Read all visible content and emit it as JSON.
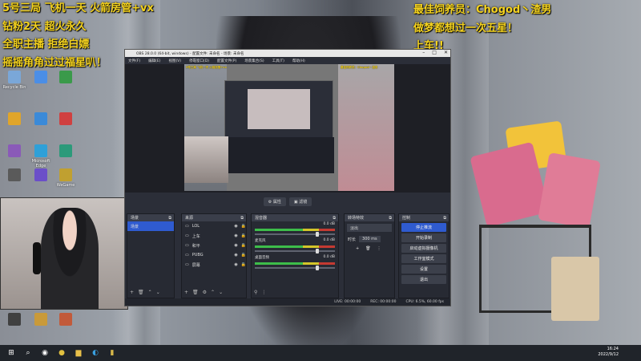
{
  "overlay": {
    "left_lines": [
      "5号三局 飞机一天 火箭房管+vx",
      "钻粉2天  超火永久",
      "全职主播 拒绝白嫖",
      "摇摇角角过过福星叭！"
    ],
    "right_lines": [
      "最佳饲养员：Chogod丶渣男",
      "做梦都想过一次五星！",
      "上车!!"
    ]
  },
  "desktop_icons": [
    {
      "label": "Recycle Bin",
      "color": "#7aa7d8"
    },
    {
      "label": "",
      "color": "#4b8ee6"
    },
    {
      "label": "",
      "color": "#3a9a4a"
    },
    {
      "label": "",
      "color": "#e0a52a"
    },
    {
      "label": "",
      "color": "#3b8ad8"
    },
    {
      "label": "",
      "color": "#d04040"
    },
    {
      "label": "",
      "color": "#8a5ab8"
    },
    {
      "label": "Microsoft Edge",
      "color": "#2fa0d8"
    },
    {
      "label": "",
      "color": "#2c9a7a"
    },
    {
      "label": "",
      "color": "#5a5a5a"
    },
    {
      "label": "",
      "color": "#6b4fc9"
    },
    {
      "label": "WeGame",
      "color": "#c0a030"
    },
    {
      "label": "",
      "color": "#404040"
    },
    {
      "label": "",
      "color": "#c99a3a"
    },
    {
      "label": "",
      "color": "#c25a3a"
    }
  ],
  "obs": {
    "title": "OBS 28.0.0 (64-bit, windows) - 配置文件: 未命名 - 场景: 未命名",
    "menu": [
      "文件(F)",
      "编辑(E)",
      "视图(V)",
      "停靠窗口(D)",
      "配置文件(P)",
      "场景集合(S)",
      "工具(T)",
      "帮助(H)"
    ],
    "preview_buttons": [
      "⚙ 属性",
      "▣ 滤镜"
    ],
    "docks": {
      "scenes": {
        "title": "场景",
        "items": [
          "场景"
        ]
      },
      "sources": {
        "title": "来源",
        "items": [
          "LOL",
          "上车",
          "和平",
          "PUBG",
          "屏幕"
        ]
      },
      "mixer": {
        "title": "混音器",
        "channels": [
          {
            "name": "",
            "db": "0.0 dB"
          },
          {
            "name": "麦克风",
            "db": "0.0 dB"
          },
          {
            "name": "桌面音频",
            "db": "0.0 dB"
          }
        ]
      },
      "transitions": {
        "title": "转场特效",
        "type": "淡出",
        "duration_label": "时长",
        "duration": "300 ms"
      },
      "controls": {
        "title": "控制",
        "buttons": [
          "停止推流",
          "开始录制",
          "启动虚拟摄像机",
          "工作室模式",
          "设置",
          "退出"
        ]
      }
    },
    "status": {
      "live": "LIVE: 00:00:00",
      "rec": "REC: 00:00:00",
      "cpu": "CPU: 6.5%, 60.00 fps"
    }
  },
  "taskbar": {
    "time": "16:24",
    "date": "2022/9/12"
  }
}
